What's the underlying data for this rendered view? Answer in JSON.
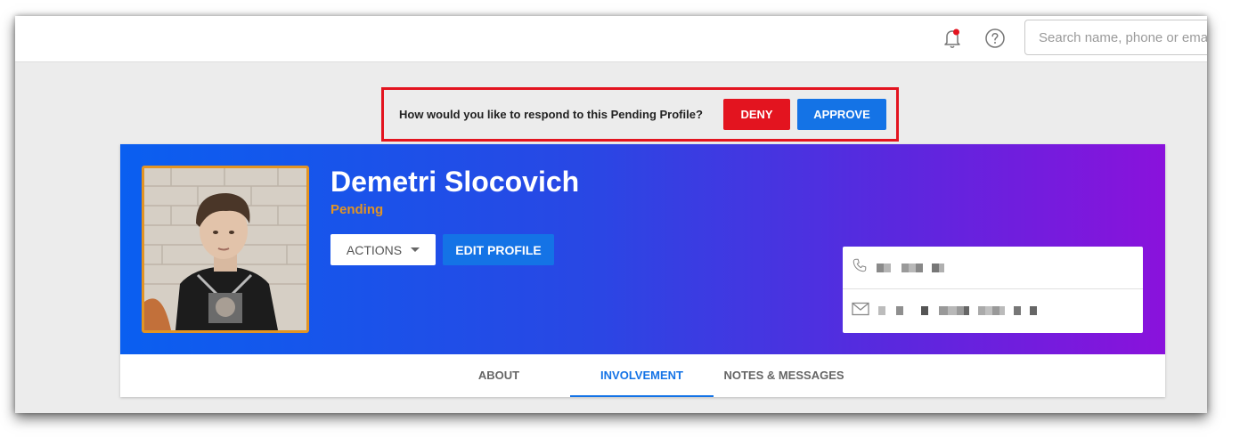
{
  "topbar": {
    "notifications_icon": "bell-icon",
    "help_icon": "question-circle-icon",
    "search_placeholder": "Search name, phone or email"
  },
  "pending": {
    "question": "How would you like to respond to this Pending Profile?",
    "deny_label": "DENY",
    "approve_label": "APPROVE"
  },
  "profile": {
    "name": "Demetri Slocovich",
    "status": "Pending",
    "actions_label": "ACTIONS",
    "edit_label": "EDIT PROFILE",
    "phone_icon": "phone-icon",
    "email_icon": "envelope-icon"
  },
  "tabs": [
    {
      "label": "ABOUT"
    },
    {
      "label": "INVOLVEMENT",
      "active": true
    },
    {
      "label": "NOTES & MESSAGES"
    }
  ],
  "colors": {
    "accent_blue": "#1473e6",
    "deny_red": "#e3141f",
    "pending_orange": "#e29424",
    "hero_start": "#0a5ff0",
    "hero_end": "#8a12dc"
  }
}
